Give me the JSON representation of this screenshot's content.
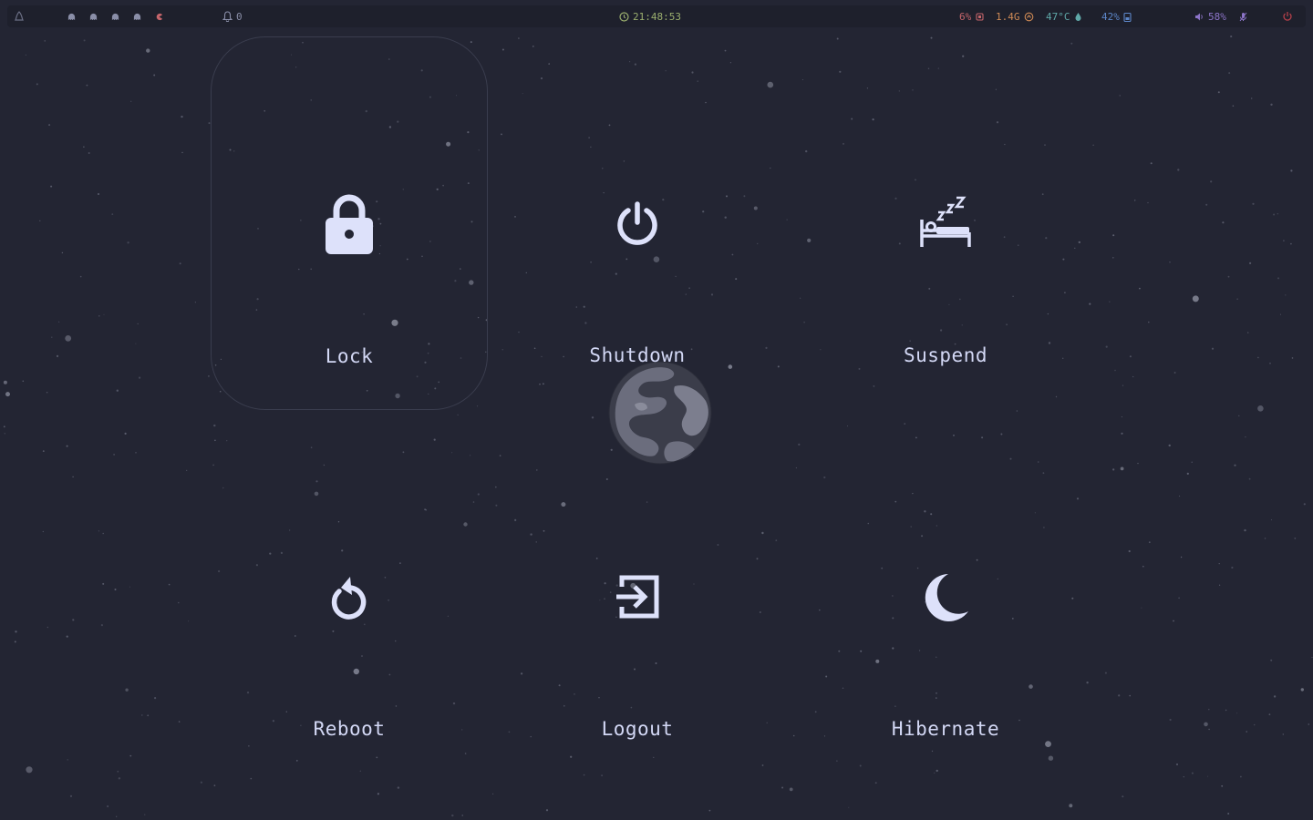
{
  "topbar": {
    "notifications_count": "0",
    "clock": "21:48:53",
    "cpu": "6%",
    "memory": "1.4G",
    "temperature": "47°C",
    "battery": "42%",
    "volume": "58%"
  },
  "colors": {
    "background": "#232533",
    "bar": "#1e202c",
    "label": "#d3d8f5",
    "icon": "#dde1fa",
    "clock": "#9aae6e",
    "cpu": "#c5656b",
    "memory": "#cf8a55",
    "temperature": "#5fa8a8",
    "battery": "#5c86c8",
    "volume": "#8c74c8",
    "power": "#b3404a"
  },
  "menu": {
    "options": [
      {
        "label": "Lock",
        "icon": "lock-icon"
      },
      {
        "label": "Shutdown",
        "icon": "power-icon"
      },
      {
        "label": "Suspend",
        "icon": "sleeping-bed-icon"
      },
      {
        "label": "Reboot",
        "icon": "restart-icon"
      },
      {
        "label": "Logout",
        "icon": "logout-icon"
      },
      {
        "label": "Hibernate",
        "icon": "moon-icon"
      }
    ],
    "selected": "Lock"
  }
}
